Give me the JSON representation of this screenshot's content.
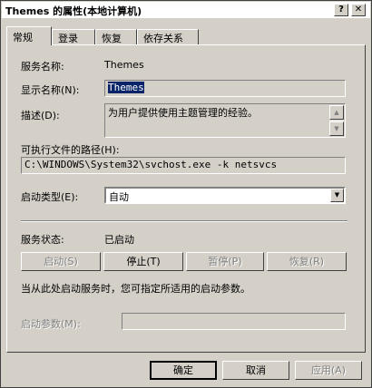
{
  "window": {
    "title": "Themes 的属性(本地计算机)",
    "help_glyph": "?",
    "close_glyph": "✕"
  },
  "tabs": [
    {
      "label": "常规",
      "key": "G"
    },
    {
      "label": "登录",
      "key": ""
    },
    {
      "label": "恢复",
      "key": ""
    },
    {
      "label": "依存关系",
      "key": ""
    }
  ],
  "general": {
    "service_name_label": "服务名称:",
    "service_name_value": "Themes",
    "display_name_label": "显示名称(N):",
    "display_name_value": "Themes",
    "description_label": "描述(D):",
    "description_value": "为用户提供使用主题管理的经验。",
    "path_label": "可执行文件的路径(H):",
    "path_value": "C:\\WINDOWS\\System32\\svchost.exe -k netsvcs",
    "startup_type_label": "启动类型(E):",
    "startup_type_value": "自动",
    "status_label": "服务状态:",
    "status_value": "已启动",
    "start_button": "启动(S)",
    "stop_button": "停止(T)",
    "pause_button": "暂停(P)",
    "resume_button": "恢复(R)",
    "hint_text": "当从此处启动服务时，您可指定所适用的启动参数。",
    "start_params_label": "启动参数(M):",
    "start_params_value": ""
  },
  "footer": {
    "ok_button": "确定",
    "cancel_button": "取消",
    "apply_button": "应用(A)"
  },
  "icons": {
    "scroll_up": "▲",
    "scroll_down": "▼",
    "combo_arrow": "▼"
  }
}
